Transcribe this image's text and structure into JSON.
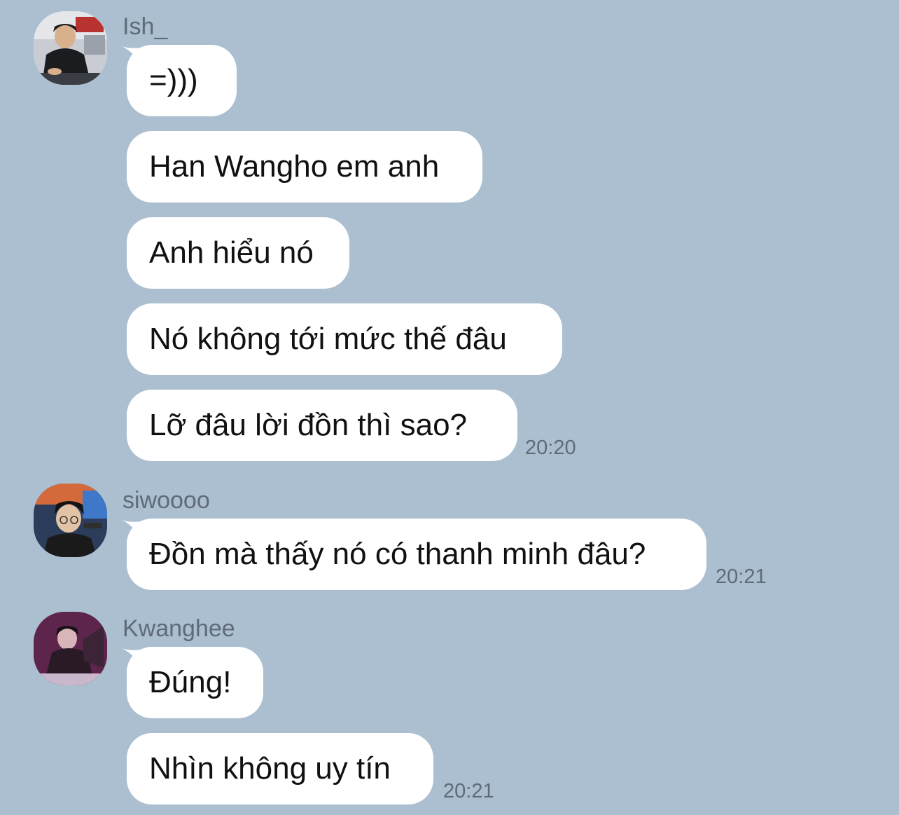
{
  "chat": {
    "groups": [
      {
        "sender": "Ish_",
        "avatar_icon": "user-avatar-photo",
        "messages": [
          "=)))",
          "Han Wangho em anh",
          "Anh hiểu nó",
          "Nó không tới mức thế đâu",
          "Lỡ đâu lời đồn thì sao?"
        ],
        "time": "20:20"
      },
      {
        "sender": "siwoooo",
        "avatar_icon": "user-avatar-photo",
        "messages": [
          "Đồn mà thấy nó có thanh minh đâu?"
        ],
        "time": "20:21"
      },
      {
        "sender": "Kwanghee",
        "avatar_icon": "user-avatar-photo",
        "messages": [
          "Đúng!",
          "Nhìn không uy tín"
        ],
        "time": "20:21"
      }
    ]
  },
  "colors": {
    "background": "#abbfd1",
    "bubble": "#ffffff",
    "meta_text": "#5f6b78",
    "message_text": "#111111"
  }
}
